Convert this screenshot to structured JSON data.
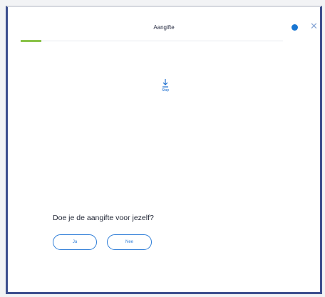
{
  "window": {
    "title": "Aangifte"
  },
  "progress": {
    "fraction": 0.08
  },
  "step": {
    "icon": "step-marker-icon",
    "label": "Stap"
  },
  "form": {
    "question": "Doe je de aangifte voor jezelf?",
    "yes_label": "Ja",
    "no_label": "Nee"
  },
  "colors": {
    "accent": "#2f7ed8",
    "progress": "#8bc34a",
    "help_dot": "#1976d2",
    "frame": "#3d4f8e"
  },
  "icons": {
    "help": "help-dot-icon",
    "close": "close-icon"
  }
}
